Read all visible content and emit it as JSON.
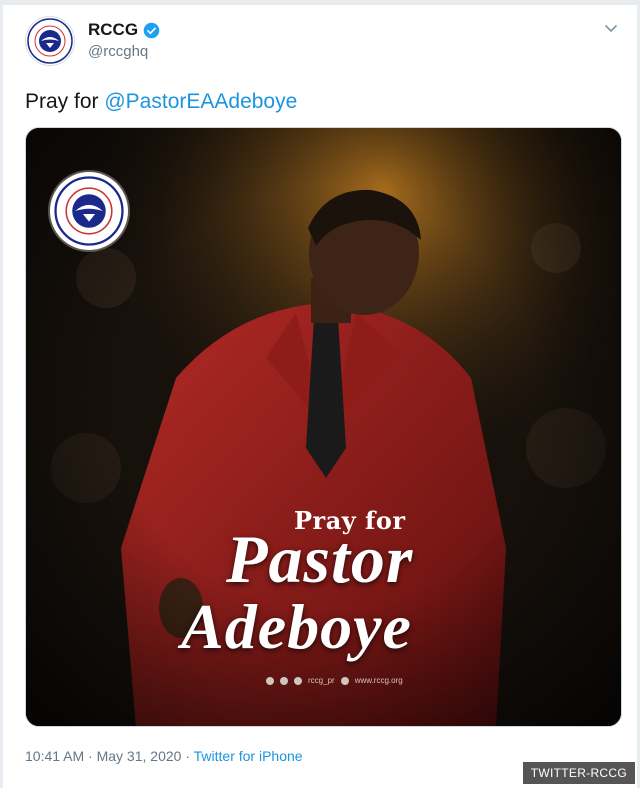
{
  "account": {
    "display_name": "RCCG",
    "handle": "@rccghq",
    "verified": true
  },
  "tweet": {
    "text_prefix": "Pray for ",
    "mention": "@PastorEAAdeboye",
    "timestamp": "10:41 AM · May 31, 2020 · ",
    "source": "Twitter for iPhone"
  },
  "poster": {
    "kicker": "Pray for",
    "headline_line1": "Pastor",
    "headline_line2": "Adeboye",
    "footer_handle": "rccg_pr",
    "footer_site": "www.rccg.org"
  },
  "image_credit": "TWITTER-RCCG",
  "colors": {
    "link": "#1b95e0",
    "verified": "#1da1f2",
    "logo_blue": "#1b2a8a"
  },
  "icons": {
    "caret": "chevron-down-icon",
    "verified": "verified-badge-icon",
    "logo": "rccg-logo-icon"
  }
}
